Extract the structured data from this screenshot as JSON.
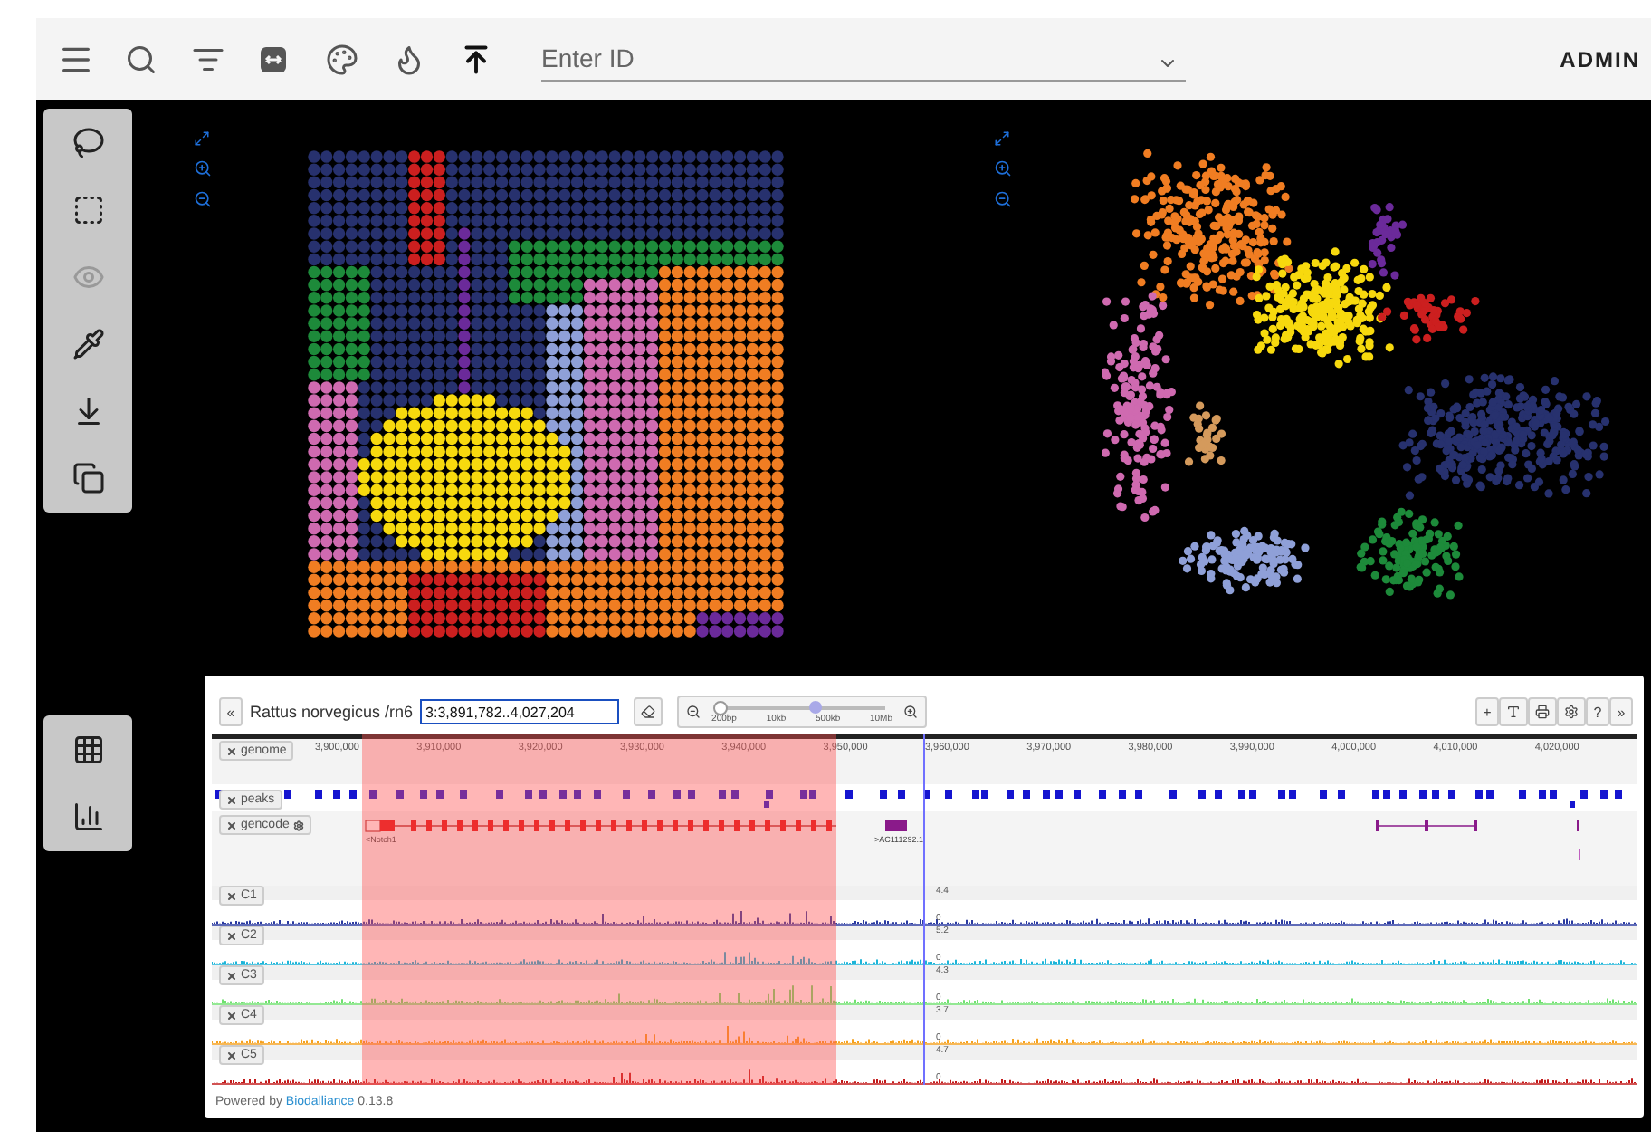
{
  "toolbar": {
    "id_field": {
      "placeholder": "Enter ID"
    },
    "user": "ADMIN"
  },
  "tool_groups": [
    {
      "tools": [
        {
          "kind": "lasso",
          "disabled": false
        },
        {
          "kind": "box_select",
          "disabled": false
        },
        {
          "kind": "eye",
          "disabled": true
        },
        {
          "kind": "pipette",
          "disabled": false
        },
        {
          "kind": "download",
          "disabled": false
        },
        {
          "kind": "copy",
          "disabled": false
        }
      ]
    },
    {
      "tools": [
        {
          "kind": "table",
          "disabled": false
        },
        {
          "kind": "chart",
          "disabled": false
        }
      ]
    }
  ],
  "plots": [
    {
      "kind": "spatial"
    },
    {
      "kind": "embedding"
    }
  ],
  "browser": {
    "collapse_button": "«",
    "species": "Rattus norvegicus /rn6",
    "location": "3:3,891,782..4,027,204",
    "slider": {
      "labels": [
        "200bp",
        "10kb",
        "500kb",
        "10Mb"
      ],
      "level": 0.58
    },
    "right_buttons": [
      {
        "kind": "text",
        "label": "+"
      },
      {
        "kind": "font"
      },
      {
        "kind": "print"
      },
      {
        "kind": "settings"
      },
      {
        "kind": "text",
        "label": "?"
      },
      {
        "kind": "text",
        "label": "»"
      }
    ],
    "ruler": [
      "3,900,000",
      "3,910,000",
      "3,920,000",
      "3,930,000",
      "3,940,000",
      "3,950,000",
      "3,960,000",
      "3,970,000",
      "3,980,000",
      "3,990,000",
      "4,000,000",
      "4,010,000",
      "4,020,000"
    ],
    "tracks": [
      {
        "kind": "ruler",
        "name": "genome"
      },
      {
        "kind": "peaks",
        "name": "peaks"
      },
      {
        "kind": "genes",
        "name": "gencode",
        "genes": [
          "<Notch1",
          ">AC111292.1"
        ]
      },
      {
        "kind": "signal",
        "name": "C1",
        "color": "#2a3aa0",
        "max": "4.4",
        "min": "0"
      },
      {
        "kind": "signal",
        "name": "C2",
        "color": "#1cb4d8",
        "max": "5.2",
        "min": "0"
      },
      {
        "kind": "signal",
        "name": "C3",
        "color": "#6fe06f",
        "max": "4.3",
        "min": "0"
      },
      {
        "kind": "signal",
        "name": "C4",
        "color": "#f5a11e",
        "max": "3.7",
        "min": "0"
      },
      {
        "kind": "signal",
        "name": "C5",
        "color": "#c21a1a",
        "max": "4.7",
        "min": "0"
      }
    ],
    "footer": {
      "prefix": "Powered by",
      "link": "Biodalliance",
      "version": "0.13.8"
    }
  }
}
